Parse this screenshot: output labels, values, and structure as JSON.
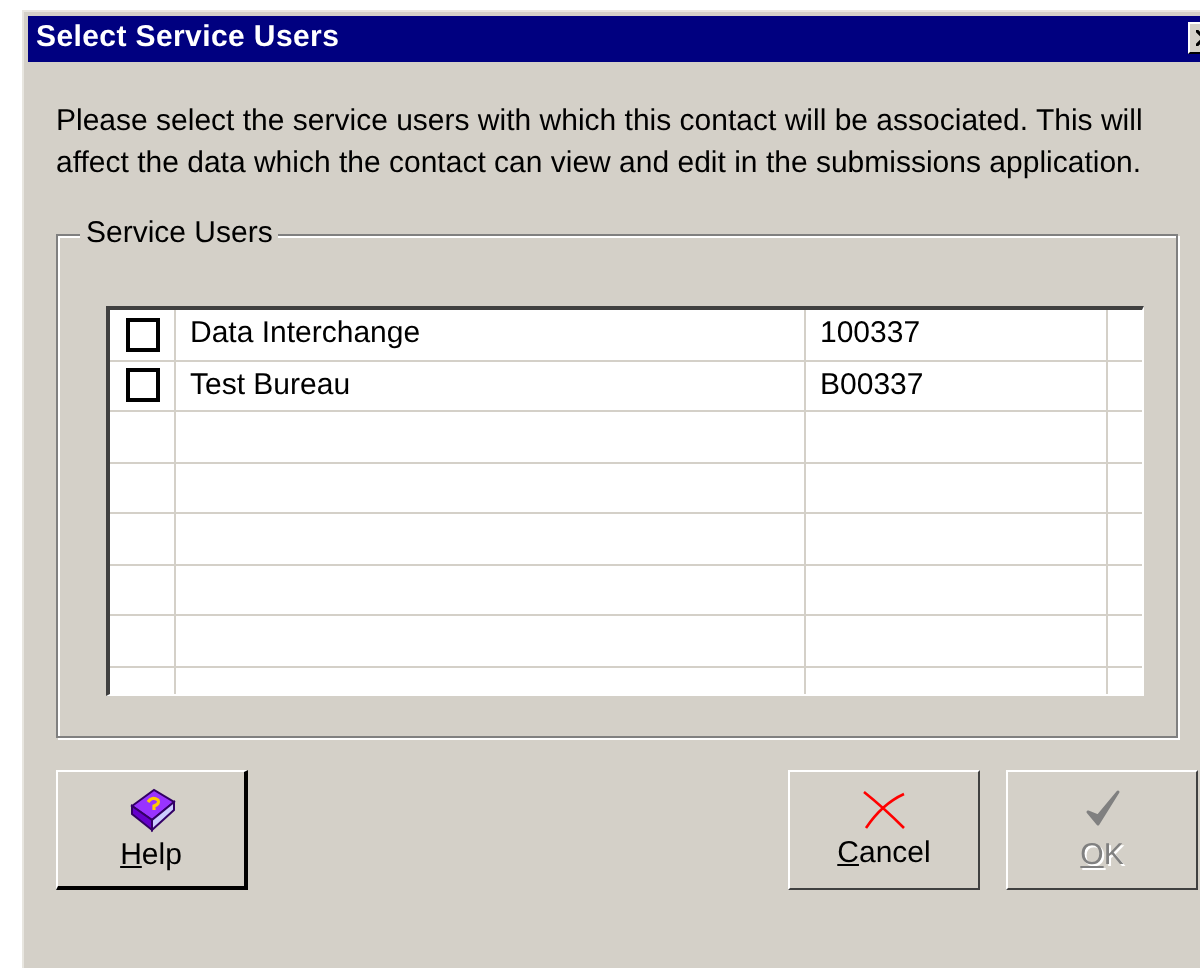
{
  "window": {
    "title": "Select Service Users"
  },
  "instructions": "Please select the service users with which this contact will be associated. This will affect the data which the contact can view and edit in the submissions application.",
  "group": {
    "label": "Service Users"
  },
  "rows": [
    {
      "checked": false,
      "name": "Data Interchange",
      "code": "100337"
    },
    {
      "checked": false,
      "name": "Test Bureau",
      "code": "B00337"
    }
  ],
  "buttons": [
    {
      "kind": "help",
      "label": "Help",
      "disabled": false
    },
    {
      "kind": "cancel",
      "label": "Cancel",
      "disabled": false
    },
    {
      "kind": "ok",
      "label": "OK",
      "disabled": true
    }
  ]
}
